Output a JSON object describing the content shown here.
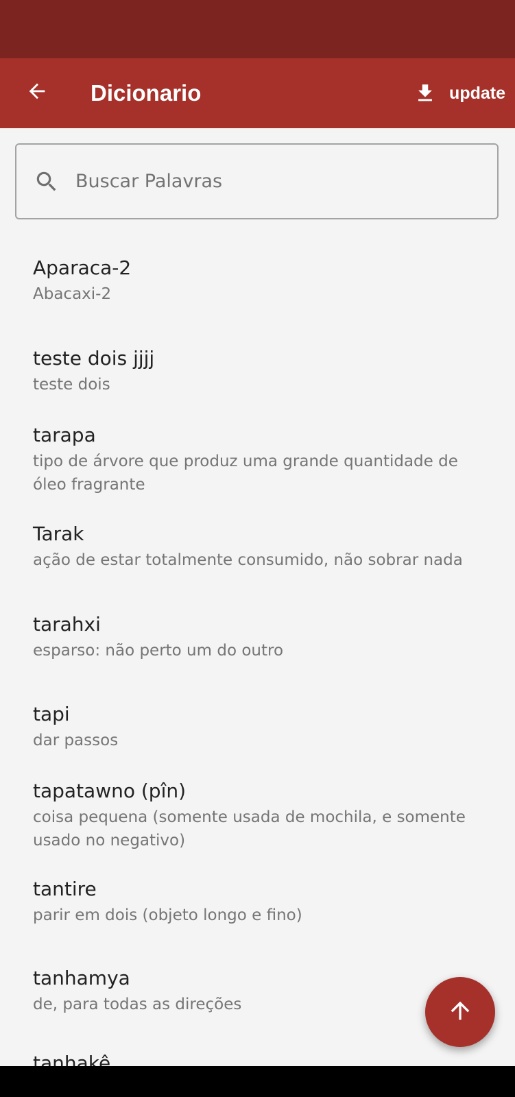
{
  "app_bar": {
    "title": "Dicionario",
    "update_label": "update"
  },
  "search": {
    "placeholder": "Buscar Palavras",
    "value": ""
  },
  "words": [
    {
      "term": "Aparaca-2",
      "definition": "Abacaxi-2"
    },
    {
      "term": "teste dois jjjj",
      "definition": "teste dois"
    },
    {
      "term": "tarapa",
      "definition": "tipo de árvore que produz uma grande quantidade de óleo fragrante"
    },
    {
      "term": "Tarak",
      "definition": "ação de estar totalmente consumido, não sobrar nada"
    },
    {
      "term": "tarahxi",
      "definition": "esparso: não perto um do outro"
    },
    {
      "term": "tapi",
      "definition": "dar passos"
    },
    {
      "term": "tapatawno (pîn)",
      "definition": "coisa pequena (somente usada de mochila, e somente usado no negativo)"
    },
    {
      "term": "tantire",
      "definition": "parir em dois (objeto longo e fino)"
    },
    {
      "term": "tanhamya",
      "definition": "de, para todas as direções"
    },
    {
      "term": "tanhakê",
      "definition": ""
    }
  ],
  "colors": {
    "status_bar": "#7c2420",
    "app_bar": "#a6302a",
    "background": "#f4f4f4",
    "fab": "#a6302a"
  },
  "icons": {
    "back": "arrow-back-icon",
    "update": "download-icon",
    "search": "search-icon",
    "fab": "arrow-up-icon"
  }
}
